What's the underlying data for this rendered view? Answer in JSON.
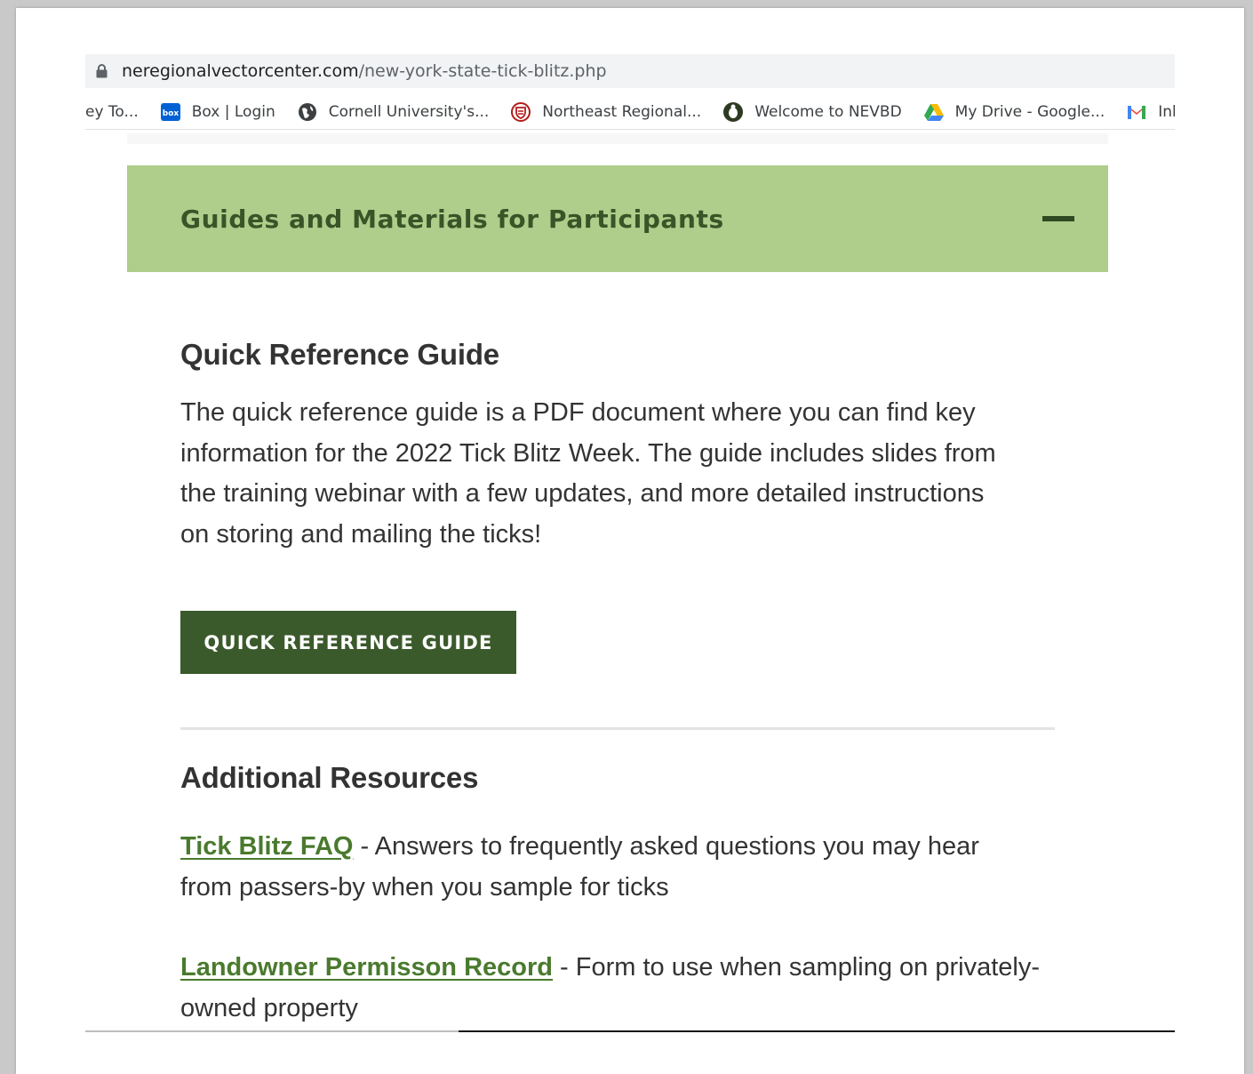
{
  "browser": {
    "url_domain": "neregionalvectorcenter.com",
    "url_path": "/new-york-state-tick-blitz.php",
    "bookmarks": [
      {
        "label": "ey To...",
        "icon": "none"
      },
      {
        "label": "Box | Login",
        "icon": "box-icon"
      },
      {
        "label": "Cornell University's...",
        "icon": "globe-icon"
      },
      {
        "label": "Northeast Regional...",
        "icon": "shield-icon"
      },
      {
        "label": "Welcome to NEVBD",
        "icon": "tick-icon"
      },
      {
        "label": "My Drive - Google...",
        "icon": "google-drive-icon"
      },
      {
        "label": "Inbox -",
        "icon": "gmail-icon"
      }
    ]
  },
  "accordion": {
    "title": "Guides and Materials for Participants",
    "state": "expanded"
  },
  "quick_ref": {
    "heading": "Quick Reference Guide",
    "lines": [
      "The quick reference guide is a PDF document where you can find key",
      "information for the 2022 Tick Blitz Week. The guide includes slides from",
      "the training webinar with a few updates, and more detailed instructions",
      "on storing and mailing the ticks!"
    ],
    "button_label": "QUICK REFERENCE GUIDE"
  },
  "resources": {
    "heading": "Additional Resources",
    "items": [
      {
        "link": "Tick Blitz FAQ",
        "line1": " - Answers to frequently asked questions you may hear",
        "line2": "from passers-by when you sample for ticks"
      },
      {
        "link": "Landowner Permisson Record",
        "line1": " - Form to use when sampling on privately-",
        "line2": "owned property"
      }
    ]
  },
  "colors": {
    "accordion_bg": "#afcd8b",
    "accordion_text": "#3a5428",
    "button_bg": "#3b5a2c",
    "link": "#4a7a2e"
  }
}
